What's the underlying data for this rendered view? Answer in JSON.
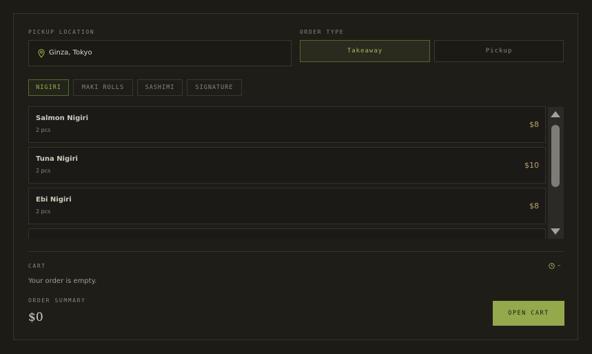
{
  "pickup": {
    "label": "PICKUP LOCATION",
    "value": "Ginza, Tokyo",
    "icon": "map-pin-icon"
  },
  "order_type": {
    "label": "ORDER TYPE",
    "options": [
      {
        "label": "Takeaway",
        "selected": true
      },
      {
        "label": "Pickup",
        "selected": false
      }
    ]
  },
  "tabs": [
    {
      "label": "NIGIRI",
      "active": true
    },
    {
      "label": "MAKI ROLLS",
      "active": false
    },
    {
      "label": "SASHIMI",
      "active": false
    },
    {
      "label": "SIGNATURE",
      "active": false
    }
  ],
  "menu_items": [
    {
      "name": "Salmon Nigiri",
      "qty": "2 pcs",
      "price": "$8"
    },
    {
      "name": "Tuna Nigiri",
      "qty": "2 pcs",
      "price": "$10"
    },
    {
      "name": "Ebi Nigiri",
      "qty": "2 pcs",
      "price": "$8"
    }
  ],
  "cart": {
    "label": "CART",
    "empty_text": "Your order is empty.",
    "timer_text": "–",
    "timer_icon": "clock-icon"
  },
  "summary": {
    "label": "ORDER SUMMARY",
    "total": "$0"
  },
  "cta": {
    "label": "OPEN CART"
  },
  "colors": {
    "accent": "#93a94c",
    "background": "#1d1b16",
    "price": "#b8a172"
  }
}
